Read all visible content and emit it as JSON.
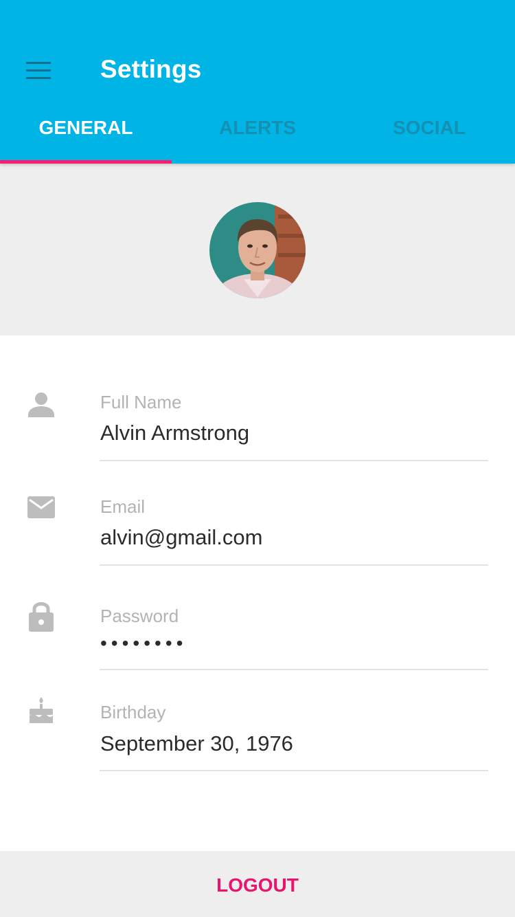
{
  "app": {
    "title": "Settings",
    "accent_color": "#00B4E6",
    "highlight_color": "#FF1C6E",
    "menu_icon": "hamburger-menu-icon"
  },
  "tabs": [
    {
      "label": "GENERAL",
      "active": true
    },
    {
      "label": "ALERTS",
      "active": false
    },
    {
      "label": "SOCIAL",
      "active": false
    }
  ],
  "profile": {
    "avatar_icon": "user-avatar-photo"
  },
  "fields": [
    {
      "icon": "person-icon",
      "label": "Full Name",
      "value": "Alvin Armstrong"
    },
    {
      "icon": "mail-icon",
      "label": "Email",
      "value": "alvin@gmail.com"
    },
    {
      "icon": "lock-icon",
      "label": "Password",
      "value": "••••••••"
    },
    {
      "icon": "cake-icon",
      "label": "Birthday",
      "value": "September 30, 1976"
    }
  ],
  "footer": {
    "logout_label": "LOGOUT"
  }
}
